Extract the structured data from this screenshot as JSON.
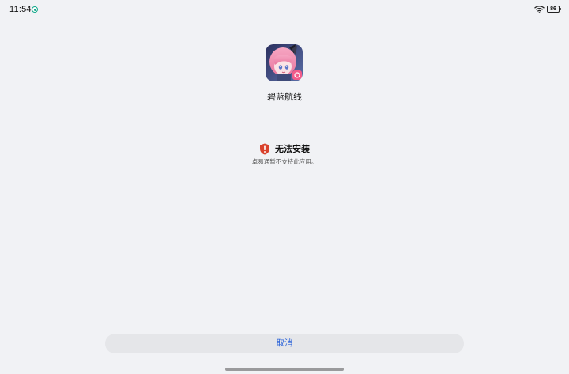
{
  "status_bar": {
    "time": "11:54",
    "battery": "86"
  },
  "app": {
    "name": "碧蓝航线"
  },
  "message": {
    "title": "无法安装",
    "subtitle": "卓易通暂不支持此应用。"
  },
  "actions": {
    "cancel_label": "取消"
  },
  "colors": {
    "background": "#f1f2f5",
    "accent": "#2b63d9",
    "warning": "#d9412c"
  }
}
